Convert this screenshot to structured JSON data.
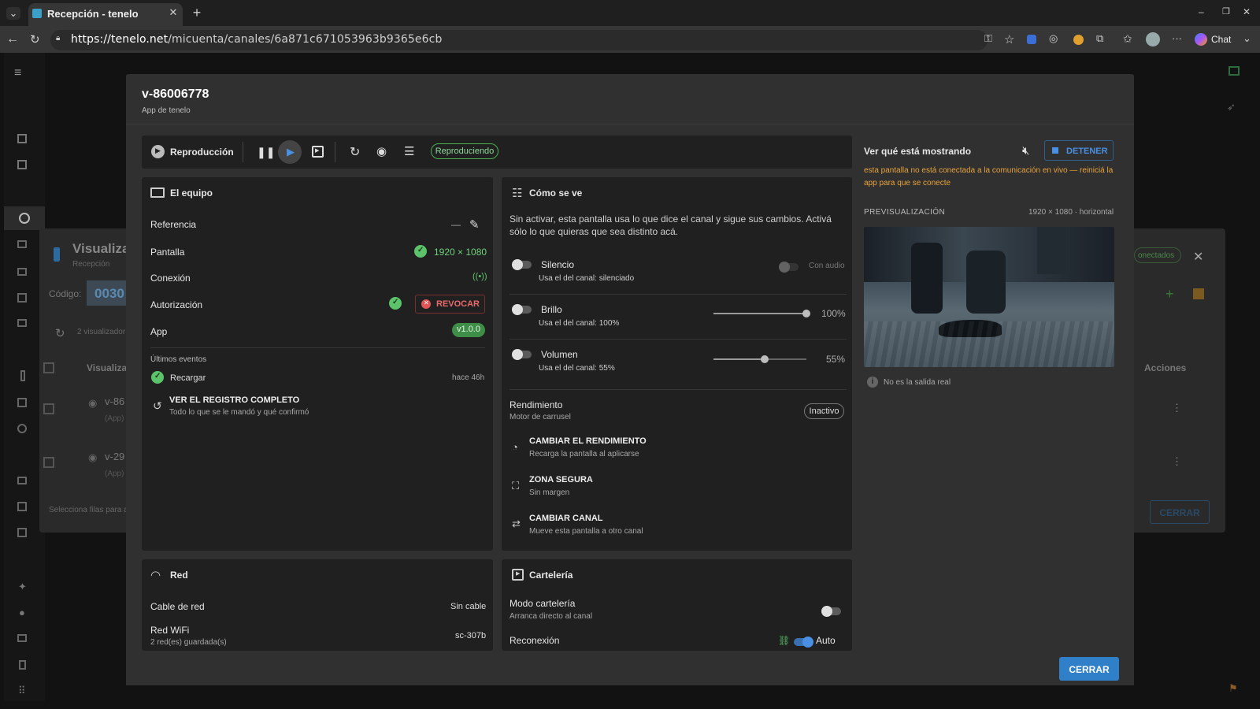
{
  "browser": {
    "tab_title": "Recepción - tenelo",
    "url_host": "https://tenelo.net",
    "url_path": "/micuenta/canales/6a871c671053963b9365e6cb",
    "chat_label": "Chat"
  },
  "underlay": {
    "title": "Visualiza",
    "subtitle": "Recepción",
    "code_label": "Código:",
    "code_value": "0030",
    "viewers": "2 visualizador",
    "col_visualiza": "Visualiza",
    "rows": [
      {
        "name": "v-86",
        "tag": "(App)"
      },
      {
        "name": "v-29",
        "tag": "(App)"
      }
    ],
    "footer": "Selecciona filas para a",
    "connected_badge": "onectados",
    "col_actions": "Acciones",
    "close_label": "CERRAR"
  },
  "dialog": {
    "title": "v-86006778",
    "subtitle": "App de tenelo",
    "close_label": "CERRAR",
    "playback": {
      "label": "Reproducción",
      "status": "Reproduciendo"
    },
    "equipo": {
      "title": "El equipo",
      "rows": {
        "referencia": {
          "label": "Referencia",
          "value": "—"
        },
        "pantalla": {
          "label": "Pantalla",
          "value": "1920 × 1080"
        },
        "conexion": {
          "label": "Conexión"
        },
        "autorizacion": {
          "label": "Autorización",
          "action": "REVOCAR"
        },
        "app": {
          "label": "App",
          "version": "v1.0.0"
        }
      },
      "events_title": "Últimos eventos",
      "event": {
        "label": "Recargar",
        "time": "hace 46h"
      },
      "log_title": "VER EL REGISTRO COMPLETO",
      "log_sub": "Todo lo que se le mandó y qué confirmó"
    },
    "como": {
      "title": "Cómo se ve",
      "desc": "Sin activar, esta pantalla usa lo que dice el canal y sigue sus cambios. Activá sólo lo que quieras que sea distinto acá.",
      "silencio": {
        "label": "Silencio",
        "sub": "Usa el del canal: silenciado",
        "extra": "Con audio"
      },
      "brillo": {
        "label": "Brillo",
        "sub": "Usa el del canal: 100%",
        "value": "100%",
        "level": 1.0
      },
      "volumen": {
        "label": "Volumen",
        "sub": "Usa el del canal: 55%",
        "value": "55%",
        "level": 0.55
      },
      "rendimiento": {
        "label": "Rendimiento",
        "sub": "Motor de carrusel",
        "badge": "Inactivo"
      },
      "actions": [
        {
          "title": "CAMBIAR EL RENDIMIENTO",
          "sub": "Recarga la pantalla al aplicarse"
        },
        {
          "title": "ZONA SEGURA",
          "sub": "Sin margen"
        },
        {
          "title": "CAMBIAR CANAL",
          "sub": "Mueve esta pantalla a otro canal"
        }
      ]
    },
    "red": {
      "title": "Red",
      "cable": {
        "label": "Cable de red",
        "value": "Sin cable"
      },
      "wifi": {
        "label": "Red WiFi",
        "sub": "2 red(es) guardada(s)",
        "value": "sc-307b"
      }
    },
    "carteleria": {
      "title": "Cartelería",
      "modo": {
        "label": "Modo cartelería",
        "sub": "Arranca directo al canal"
      },
      "reconexion": {
        "label": "Reconexión",
        "value": "Auto"
      }
    },
    "preview": {
      "title": "Ver qué está mostrando",
      "stop_label": "DETENER",
      "warning": "esta pantalla no está conectada a la comunicación en vivo — reiniciá la app para que se conecte",
      "section": "PREVISUALIZACIÓN",
      "meta": "1920 × 1080 · horizontal",
      "note": "No es la salida real"
    }
  },
  "colors": {
    "accent": "#4a90e2",
    "green": "#6fd07b",
    "warning": "#e8a33a",
    "danger": "#e05555"
  }
}
